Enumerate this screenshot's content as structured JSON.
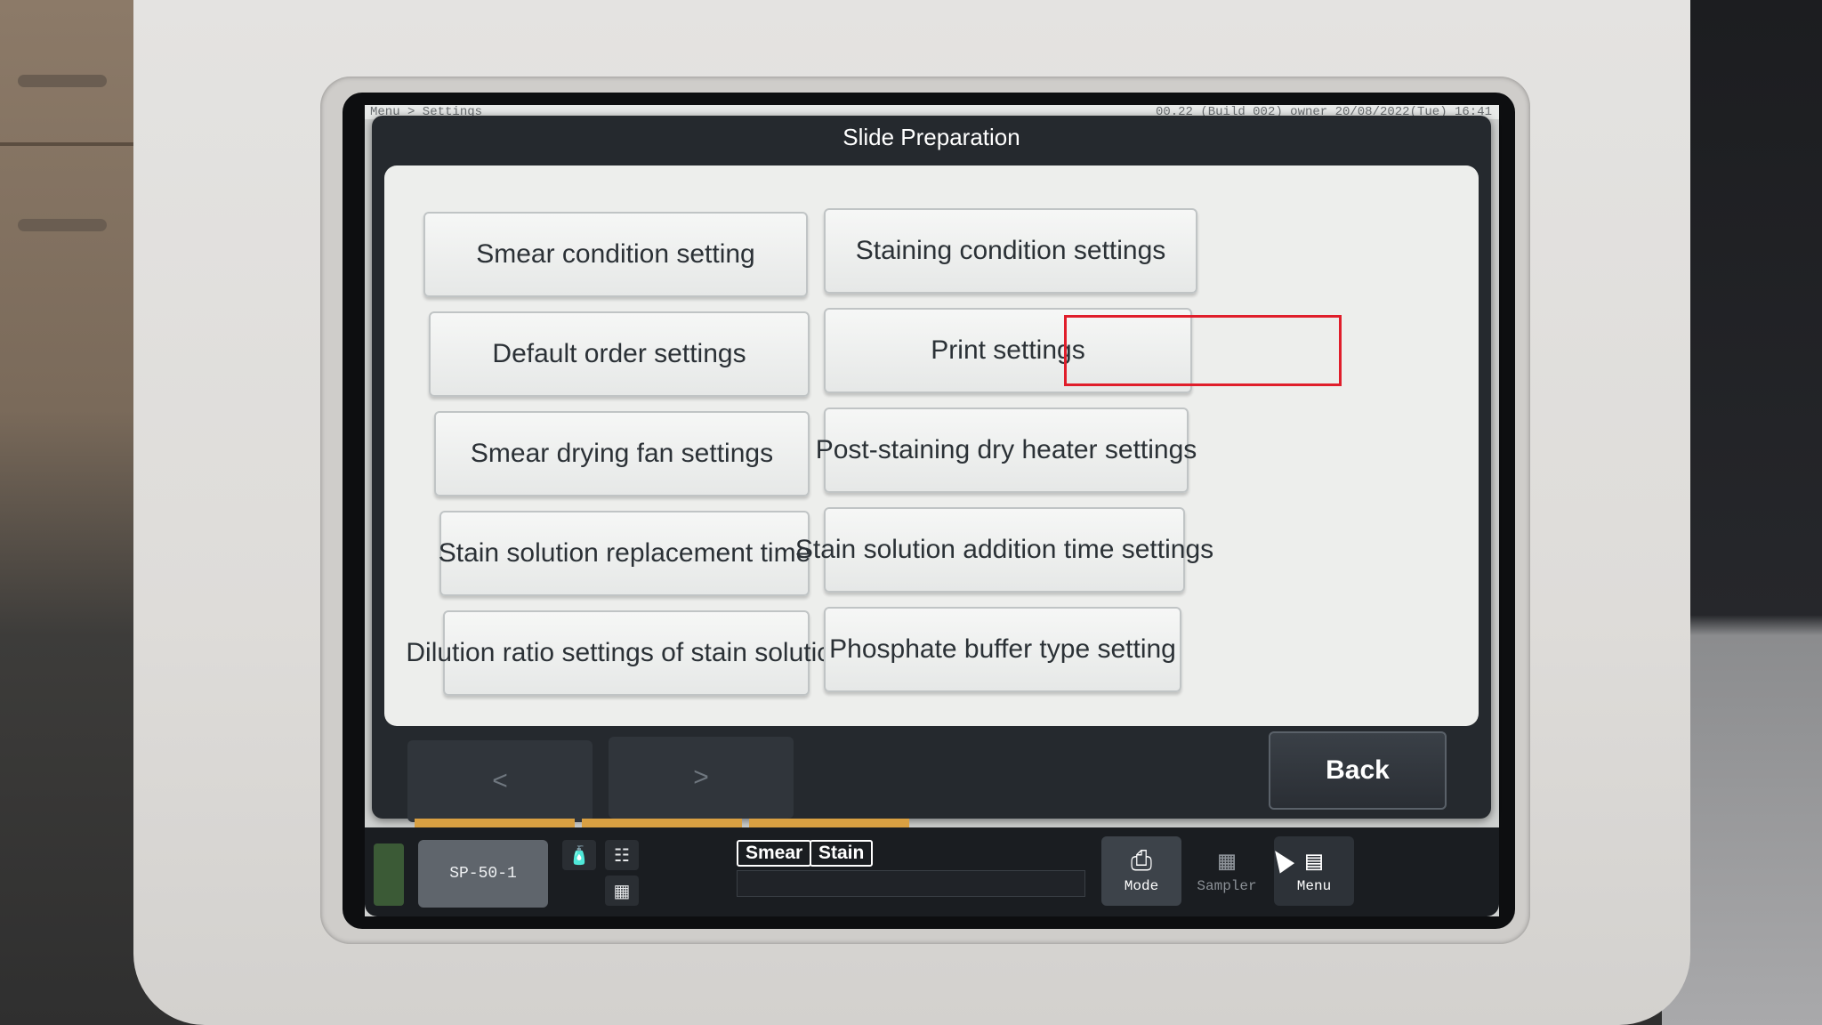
{
  "screen": {
    "breadcrumb": "Menu > Settings",
    "status_text": "00.22 (Build 002) owner 20/08/2022(Tue) 16:41"
  },
  "dialog": {
    "title": "Slide Preparation",
    "options": [
      {
        "label": "Smear condition setting"
      },
      {
        "label": "Staining condition settings"
      },
      {
        "label": "Default order settings"
      },
      {
        "label": "Print settings",
        "highlighted": true
      },
      {
        "label": "Smear drying fan settings"
      },
      {
        "label": "Post-staining dry heater settings"
      },
      {
        "label": "Stain solution replacement time"
      },
      {
        "label": "Stain solution addition time settings"
      },
      {
        "label": "Dilution ratio settings of stain solution"
      },
      {
        "label": "Phosphate buffer type setting"
      }
    ],
    "prev_label": "<",
    "next_label": ">",
    "back_label": "Back"
  },
  "bottombar": {
    "instrument_label": "SP-50-1",
    "tags": [
      "Smear",
      "Stain"
    ],
    "tools": [
      {
        "label": "Mode",
        "icon": "mode-icon"
      },
      {
        "label": "Sampler",
        "icon": "sampler-icon"
      },
      {
        "label": "Menu",
        "icon": "menu-icon"
      }
    ]
  },
  "colors": {
    "highlight": "#e01e2b",
    "dialog_bg": "#25292e",
    "status_strip": "#d9a042"
  }
}
